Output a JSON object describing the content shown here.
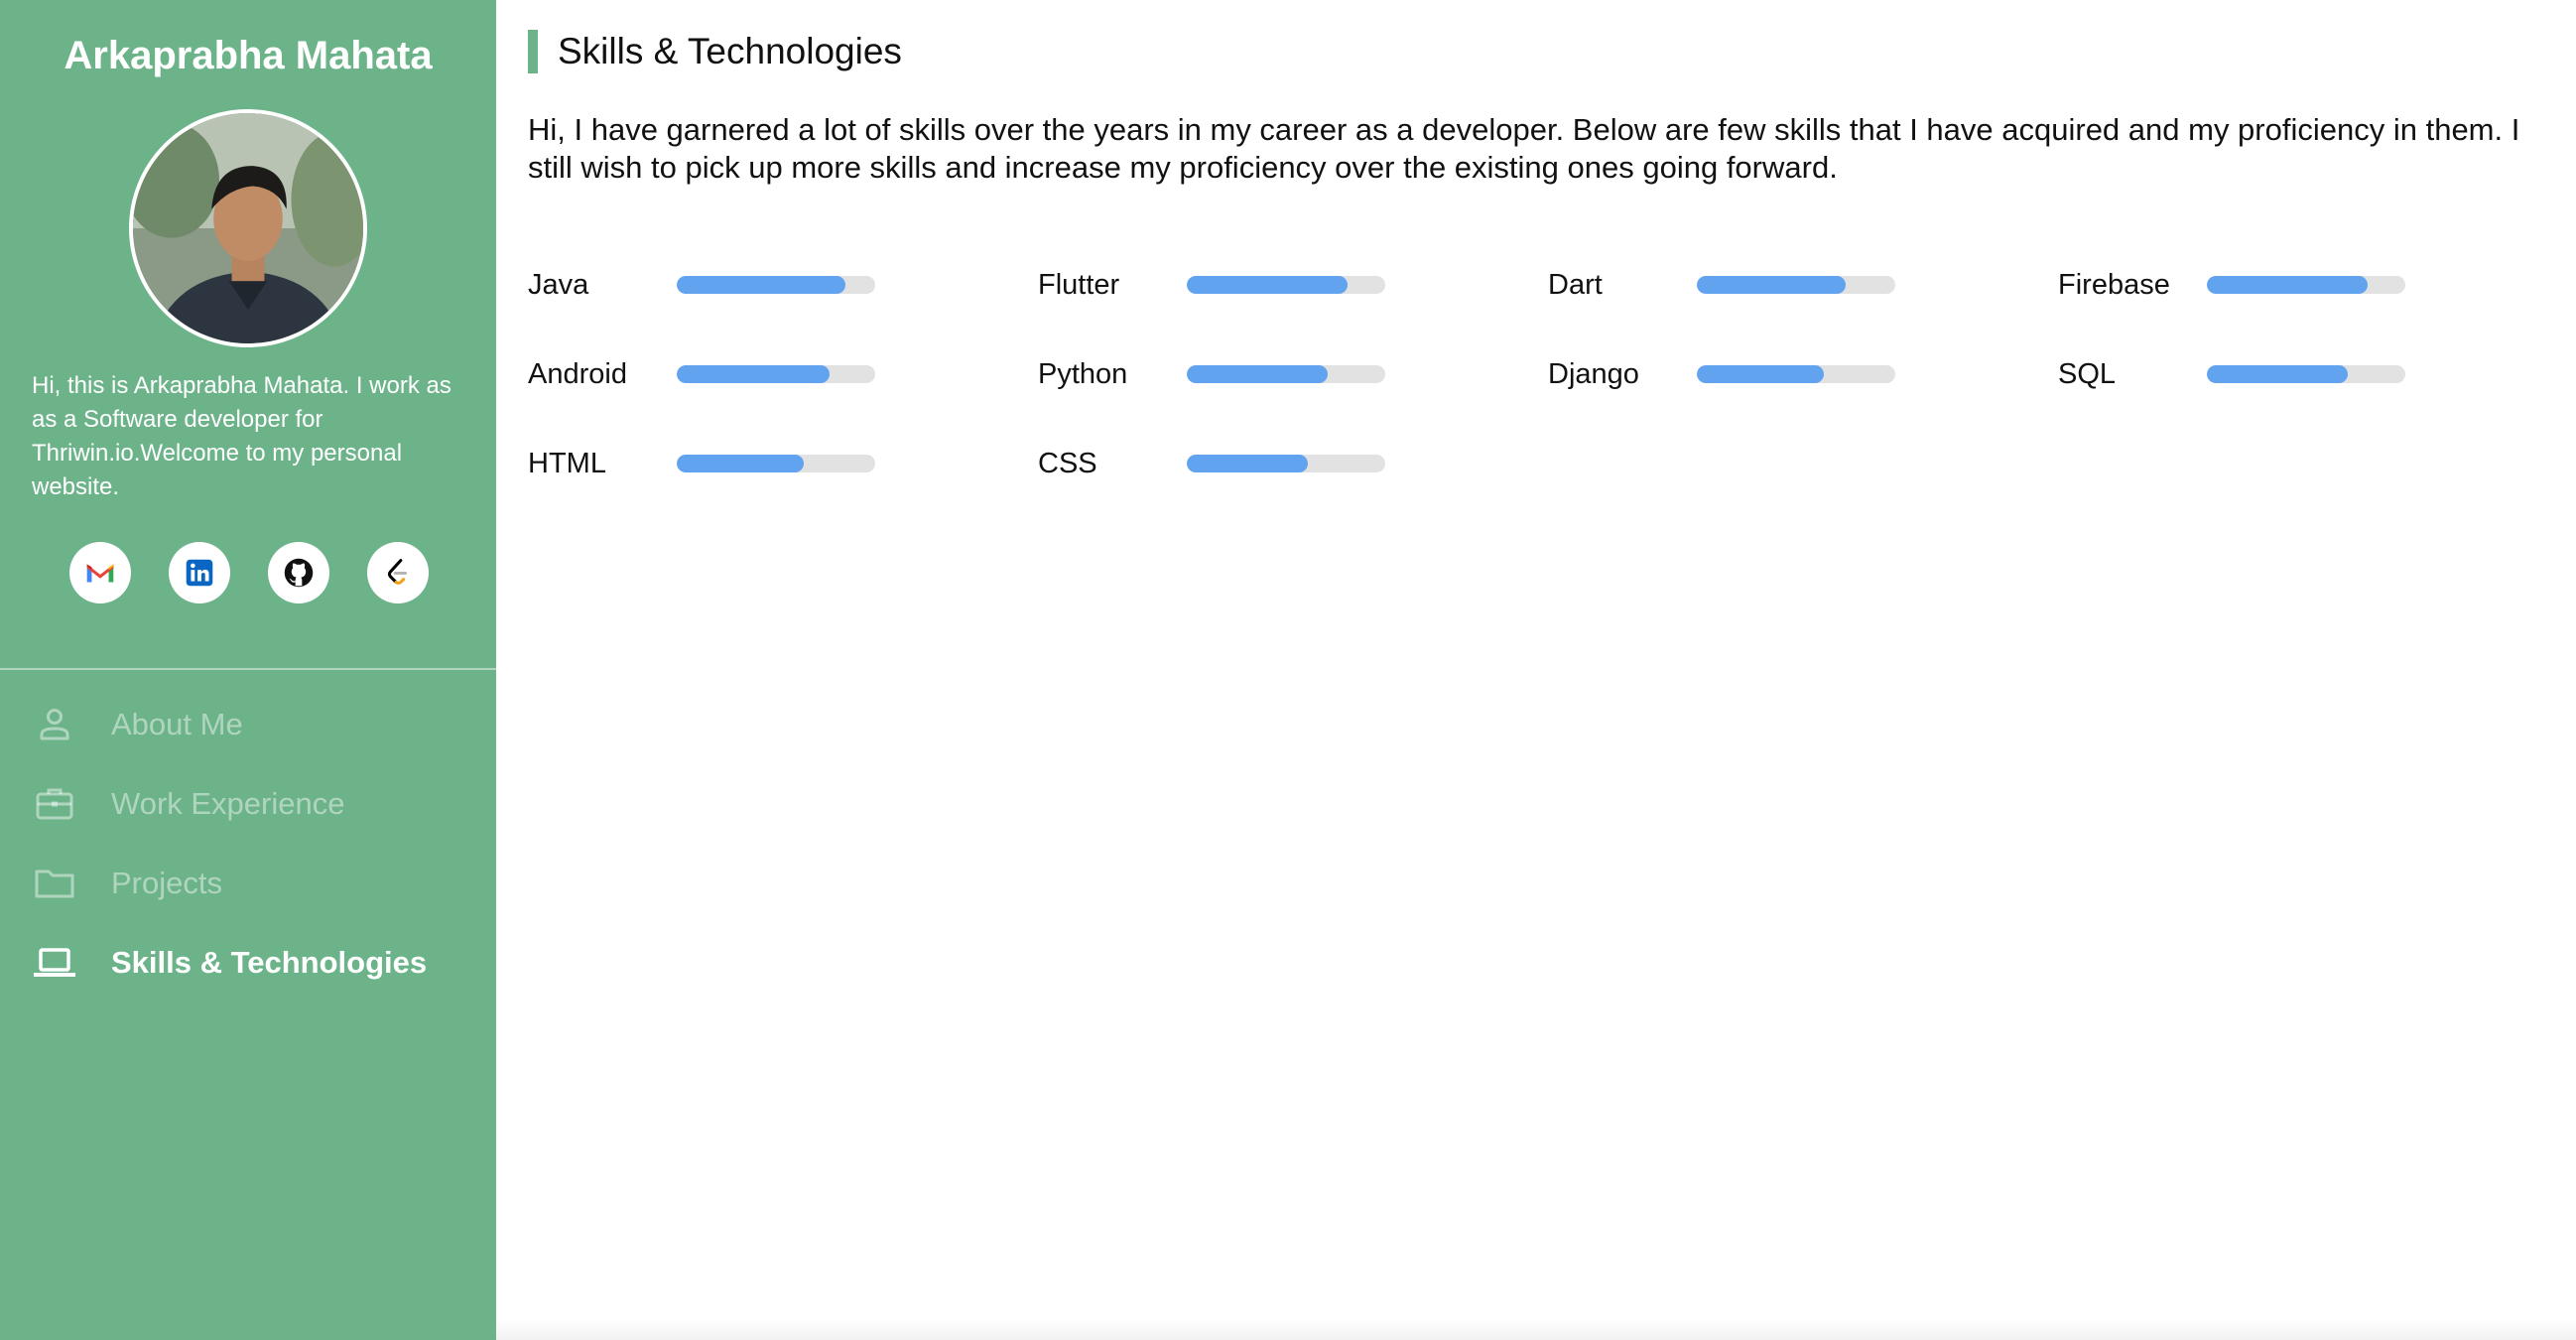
{
  "sidebar": {
    "name": "Arkaprabha Mahata",
    "bio": "Hi, this is Arkaprabha Mahata. I work as as a Software developer for Thriwin.io.Welcome to my personal website.",
    "social": [
      {
        "icon": "gmail-icon"
      },
      {
        "icon": "linkedin-icon"
      },
      {
        "icon": "github-icon"
      },
      {
        "icon": "leetcode-icon"
      }
    ],
    "nav": [
      {
        "label": "About Me",
        "icon": "person-icon",
        "active": false
      },
      {
        "label": "Work Experience",
        "icon": "briefcase-icon",
        "active": false
      },
      {
        "label": "Projects",
        "icon": "folder-icon",
        "active": false
      },
      {
        "label": "Skills & Technologies",
        "icon": "laptop-icon",
        "active": true
      }
    ]
  },
  "main": {
    "title": "Skills & Technologies",
    "intro": "Hi, I have garnered a lot of skills over the years in my career as a developer. Below are few skills that I have acquired and my proficiency in them. I still wish to pick up more skills and increase my proficiency over the existing ones going forward.",
    "skills": [
      {
        "name": "Java",
        "level": 0.85
      },
      {
        "name": "Flutter",
        "level": 0.81
      },
      {
        "name": "Dart",
        "level": 0.75
      },
      {
        "name": "Firebase",
        "level": 0.81
      },
      {
        "name": "Android",
        "level": 0.77
      },
      {
        "name": "Python",
        "level": 0.71
      },
      {
        "name": "Django",
        "level": 0.64
      },
      {
        "name": "SQL",
        "level": 0.71
      },
      {
        "name": "HTML",
        "level": 0.64
      },
      {
        "name": "CSS",
        "level": 0.61
      }
    ]
  },
  "colors": {
    "sidebar": "#6db38a",
    "bar_fill": "#62a3ef",
    "bar_track": "#e2e2e2",
    "accent": "#6db38a"
  }
}
